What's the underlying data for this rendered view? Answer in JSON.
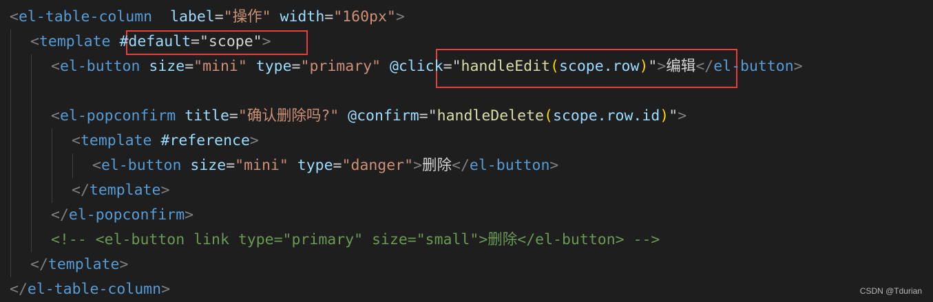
{
  "editor": {
    "theme_colors": {
      "background": "#1e1e1e",
      "tag": "#569cd6",
      "attribute": "#9cdcfe",
      "string": "#ce9178",
      "punctuation": "#808080",
      "text": "#d4d4d4",
      "comment": "#6a9955",
      "bracket": "#ffd700",
      "highlight_box": "#e8403a"
    },
    "lines": [
      {
        "indent": 0,
        "tokens": [
          {
            "t": "<",
            "c": "punct"
          },
          {
            "t": "el-table-column",
            "c": "tag"
          },
          {
            "t": "  ",
            "c": "text"
          },
          {
            "t": "label",
            "c": "attr"
          },
          {
            "t": "=",
            "c": "text"
          },
          {
            "t": "\"操作\"",
            "c": "str"
          },
          {
            "t": " ",
            "c": "text"
          },
          {
            "t": "width",
            "c": "attr"
          },
          {
            "t": "=",
            "c": "text"
          },
          {
            "t": "\"160px\"",
            "c": "str"
          },
          {
            "t": ">",
            "c": "punct"
          }
        ]
      },
      {
        "indent": 1,
        "tokens": [
          {
            "t": "<",
            "c": "punct"
          },
          {
            "t": "template",
            "c": "tag"
          },
          {
            "t": " ",
            "c": "text"
          },
          {
            "t": "#default",
            "c": "attr"
          },
          {
            "t": "=",
            "c": "text"
          },
          {
            "t": "\"scope\"",
            "c": "text"
          },
          {
            "t": ">",
            "c": "punct"
          }
        ]
      },
      {
        "indent": 2,
        "tokens": [
          {
            "t": "<",
            "c": "punct"
          },
          {
            "t": "el-button",
            "c": "tag"
          },
          {
            "t": " ",
            "c": "text"
          },
          {
            "t": "size",
            "c": "attr"
          },
          {
            "t": "=",
            "c": "text"
          },
          {
            "t": "\"mini\"",
            "c": "str"
          },
          {
            "t": " ",
            "c": "text"
          },
          {
            "t": "type",
            "c": "attr"
          },
          {
            "t": "=",
            "c": "text"
          },
          {
            "t": "\"primary\"",
            "c": "str"
          },
          {
            "t": " ",
            "c": "text"
          },
          {
            "t": "@click",
            "c": "attr"
          },
          {
            "t": "=",
            "c": "text"
          },
          {
            "t": "\"",
            "c": "text"
          },
          {
            "t": "handleEdit",
            "c": "func"
          },
          {
            "t": "(",
            "c": "bracket"
          },
          {
            "t": "scope.row",
            "c": "attr"
          },
          {
            "t": ")",
            "c": "bracket"
          },
          {
            "t": "\"",
            "c": "text"
          },
          {
            "t": ">",
            "c": "punct"
          },
          {
            "t": "编辑",
            "c": "text"
          },
          {
            "t": "</",
            "c": "punct"
          },
          {
            "t": "el-button",
            "c": "tag"
          },
          {
            "t": ">",
            "c": "punct"
          }
        ]
      },
      {
        "indent": 2,
        "tokens": []
      },
      {
        "indent": 2,
        "tokens": [
          {
            "t": "<",
            "c": "punct"
          },
          {
            "t": "el-popconfirm",
            "c": "tag"
          },
          {
            "t": " ",
            "c": "text"
          },
          {
            "t": "title",
            "c": "attr"
          },
          {
            "t": "=",
            "c": "text"
          },
          {
            "t": "\"确认删除吗?\"",
            "c": "str"
          },
          {
            "t": " ",
            "c": "text"
          },
          {
            "t": "@confirm",
            "c": "attr"
          },
          {
            "t": "=",
            "c": "text"
          },
          {
            "t": "\"",
            "c": "text"
          },
          {
            "t": "handleDelete",
            "c": "func"
          },
          {
            "t": "(",
            "c": "bracket"
          },
          {
            "t": "scope.row.id",
            "c": "attr"
          },
          {
            "t": ")",
            "c": "bracket"
          },
          {
            "t": "\"",
            "c": "text"
          },
          {
            "t": ">",
            "c": "punct"
          }
        ]
      },
      {
        "indent": 3,
        "tokens": [
          {
            "t": "<",
            "c": "punct"
          },
          {
            "t": "template",
            "c": "tag"
          },
          {
            "t": " ",
            "c": "text"
          },
          {
            "t": "#reference",
            "c": "attr"
          },
          {
            "t": ">",
            "c": "punct"
          }
        ]
      },
      {
        "indent": 4,
        "tokens": [
          {
            "t": "<",
            "c": "punct"
          },
          {
            "t": "el-button",
            "c": "tag"
          },
          {
            "t": " ",
            "c": "text"
          },
          {
            "t": "size",
            "c": "attr"
          },
          {
            "t": "=",
            "c": "text"
          },
          {
            "t": "\"mini\"",
            "c": "str"
          },
          {
            "t": " ",
            "c": "text"
          },
          {
            "t": "type",
            "c": "attr"
          },
          {
            "t": "=",
            "c": "text"
          },
          {
            "t": "\"danger\"",
            "c": "str"
          },
          {
            "t": ">",
            "c": "punct"
          },
          {
            "t": "删除",
            "c": "text"
          },
          {
            "t": "</",
            "c": "punct"
          },
          {
            "t": "el-button",
            "c": "tag"
          },
          {
            "t": ">",
            "c": "punct"
          }
        ]
      },
      {
        "indent": 3,
        "tokens": [
          {
            "t": "</",
            "c": "punct"
          },
          {
            "t": "template",
            "c": "tag"
          },
          {
            "t": ">",
            "c": "punct"
          }
        ]
      },
      {
        "indent": 2,
        "tokens": [
          {
            "t": "</",
            "c": "punct"
          },
          {
            "t": "el-popconfirm",
            "c": "tag"
          },
          {
            "t": ">",
            "c": "punct"
          }
        ]
      },
      {
        "indent": 2,
        "tokens": [
          {
            "t": "<!-- <el-button link type=\"primary\" size=\"small\">删除</el-button> -->",
            "c": "comment"
          }
        ]
      },
      {
        "indent": 1,
        "tokens": [
          {
            "t": "</",
            "c": "punct"
          },
          {
            "t": "template",
            "c": "tag"
          },
          {
            "t": ">",
            "c": "punct"
          }
        ]
      },
      {
        "indent": 0,
        "tokens": [
          {
            "t": "</",
            "c": "punct"
          },
          {
            "t": "el-table-column",
            "c": "tag"
          },
          {
            "t": ">",
            "c": "punct"
          }
        ]
      }
    ]
  },
  "watermark": "CSDN @Tdurian"
}
